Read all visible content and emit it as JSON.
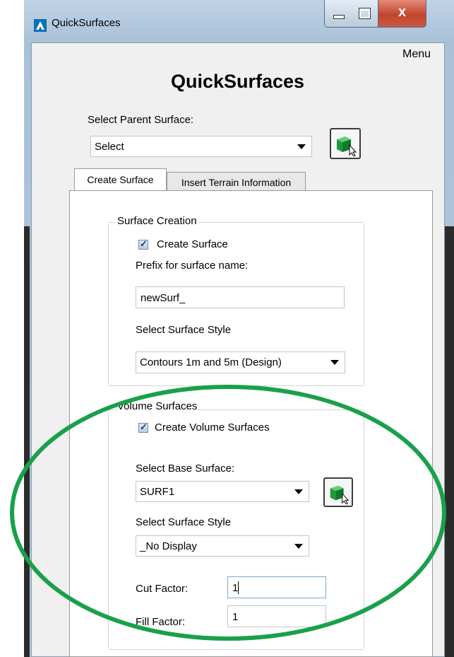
{
  "window": {
    "title": "QuickSurfaces",
    "close_glyph": "x"
  },
  "menu": {
    "label": "Menu"
  },
  "heading": "QuickSurfaces",
  "parent_surface": {
    "label": "Select Parent Surface:",
    "value": "Select"
  },
  "tabs": [
    {
      "label": "Create Surface",
      "active": true
    },
    {
      "label": "Insert Terrain Information",
      "active": false
    }
  ],
  "surface_creation": {
    "title": "Surface Creation",
    "create_label": "Create Surface",
    "create_checked": true,
    "prefix_label": "Prefix for surface name:",
    "prefix_value": "newSurf_",
    "style_label": "Select Surface Style",
    "style_value": "Contours 1m and 5m (Design)"
  },
  "volume_surfaces": {
    "title": "Volume Surfaces",
    "create_label": "Create Volume Surfaces",
    "create_checked": true,
    "base_label": "Select Base Surface:",
    "base_value": "SURF1",
    "style_label": "Select Surface Style",
    "style_value": "_No Display",
    "cut_label": "Cut Factor:",
    "cut_value": "1",
    "fill_label": "Fill Factor:",
    "fill_value": "1"
  },
  "annotation": {
    "highlight_color": "#1aa04a"
  },
  "icons": [
    "autodesk-logo-icon",
    "minimize-icon",
    "maximize-icon",
    "close-icon",
    "pick-surface-icon",
    "checkbox-checked-icon",
    "dropdown-arrow-icon"
  ]
}
